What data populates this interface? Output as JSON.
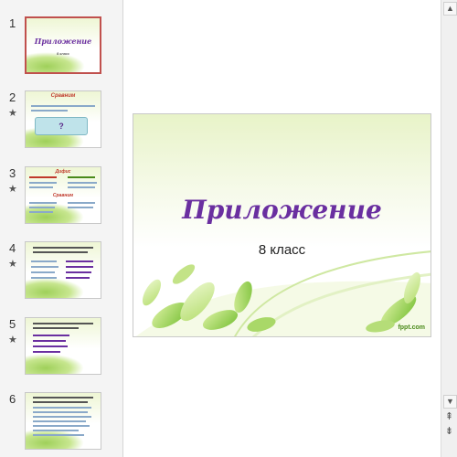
{
  "slides": [
    {
      "number": "1",
      "starred": false,
      "title": "Приложение",
      "subtitle": "8 класс"
    },
    {
      "number": "2",
      "starred": true,
      "title": "Сравним",
      "question": "?"
    },
    {
      "number": "3",
      "starred": true,
      "title": "Дифис",
      "title2": "Сравним"
    },
    {
      "number": "4",
      "starred": true
    },
    {
      "number": "5",
      "starred": true
    },
    {
      "number": "6",
      "starred": false
    }
  ],
  "star_glyph": "★",
  "main_slide": {
    "title": "Приложение",
    "subtitle": "8 класс",
    "watermark": "fppt.com"
  },
  "scrollbar": {
    "up": "▲",
    "down": "▼",
    "page_up": "⇞",
    "page_down": "⇟"
  },
  "colors": {
    "title_purple": "#6a2fa0",
    "selected_border": "#c0504d",
    "leaf_green": "#9fd05a"
  }
}
